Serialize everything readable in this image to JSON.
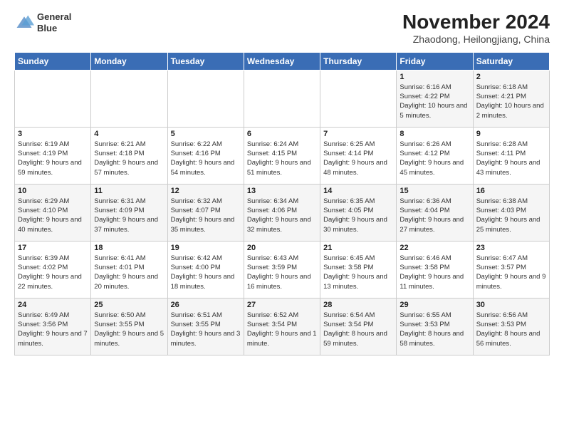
{
  "header": {
    "logo_line1": "General",
    "logo_line2": "Blue",
    "month_title": "November 2024",
    "location": "Zhaodong, Heilongjiang, China"
  },
  "weekdays": [
    "Sunday",
    "Monday",
    "Tuesday",
    "Wednesday",
    "Thursday",
    "Friday",
    "Saturday"
  ],
  "weeks": [
    [
      {
        "day": "",
        "info": ""
      },
      {
        "day": "",
        "info": ""
      },
      {
        "day": "",
        "info": ""
      },
      {
        "day": "",
        "info": ""
      },
      {
        "day": "",
        "info": ""
      },
      {
        "day": "1",
        "info": "Sunrise: 6:16 AM\nSunset: 4:22 PM\nDaylight: 10 hours and 5 minutes."
      },
      {
        "day": "2",
        "info": "Sunrise: 6:18 AM\nSunset: 4:21 PM\nDaylight: 10 hours and 2 minutes."
      }
    ],
    [
      {
        "day": "3",
        "info": "Sunrise: 6:19 AM\nSunset: 4:19 PM\nDaylight: 9 hours and 59 minutes."
      },
      {
        "day": "4",
        "info": "Sunrise: 6:21 AM\nSunset: 4:18 PM\nDaylight: 9 hours and 57 minutes."
      },
      {
        "day": "5",
        "info": "Sunrise: 6:22 AM\nSunset: 4:16 PM\nDaylight: 9 hours and 54 minutes."
      },
      {
        "day": "6",
        "info": "Sunrise: 6:24 AM\nSunset: 4:15 PM\nDaylight: 9 hours and 51 minutes."
      },
      {
        "day": "7",
        "info": "Sunrise: 6:25 AM\nSunset: 4:14 PM\nDaylight: 9 hours and 48 minutes."
      },
      {
        "day": "8",
        "info": "Sunrise: 6:26 AM\nSunset: 4:12 PM\nDaylight: 9 hours and 45 minutes."
      },
      {
        "day": "9",
        "info": "Sunrise: 6:28 AM\nSunset: 4:11 PM\nDaylight: 9 hours and 43 minutes."
      }
    ],
    [
      {
        "day": "10",
        "info": "Sunrise: 6:29 AM\nSunset: 4:10 PM\nDaylight: 9 hours and 40 minutes."
      },
      {
        "day": "11",
        "info": "Sunrise: 6:31 AM\nSunset: 4:09 PM\nDaylight: 9 hours and 37 minutes."
      },
      {
        "day": "12",
        "info": "Sunrise: 6:32 AM\nSunset: 4:07 PM\nDaylight: 9 hours and 35 minutes."
      },
      {
        "day": "13",
        "info": "Sunrise: 6:34 AM\nSunset: 4:06 PM\nDaylight: 9 hours and 32 minutes."
      },
      {
        "day": "14",
        "info": "Sunrise: 6:35 AM\nSunset: 4:05 PM\nDaylight: 9 hours and 30 minutes."
      },
      {
        "day": "15",
        "info": "Sunrise: 6:36 AM\nSunset: 4:04 PM\nDaylight: 9 hours and 27 minutes."
      },
      {
        "day": "16",
        "info": "Sunrise: 6:38 AM\nSunset: 4:03 PM\nDaylight: 9 hours and 25 minutes."
      }
    ],
    [
      {
        "day": "17",
        "info": "Sunrise: 6:39 AM\nSunset: 4:02 PM\nDaylight: 9 hours and 22 minutes."
      },
      {
        "day": "18",
        "info": "Sunrise: 6:41 AM\nSunset: 4:01 PM\nDaylight: 9 hours and 20 minutes."
      },
      {
        "day": "19",
        "info": "Sunrise: 6:42 AM\nSunset: 4:00 PM\nDaylight: 9 hours and 18 minutes."
      },
      {
        "day": "20",
        "info": "Sunrise: 6:43 AM\nSunset: 3:59 PM\nDaylight: 9 hours and 16 minutes."
      },
      {
        "day": "21",
        "info": "Sunrise: 6:45 AM\nSunset: 3:58 PM\nDaylight: 9 hours and 13 minutes."
      },
      {
        "day": "22",
        "info": "Sunrise: 6:46 AM\nSunset: 3:58 PM\nDaylight: 9 hours and 11 minutes."
      },
      {
        "day": "23",
        "info": "Sunrise: 6:47 AM\nSunset: 3:57 PM\nDaylight: 9 hours and 9 minutes."
      }
    ],
    [
      {
        "day": "24",
        "info": "Sunrise: 6:49 AM\nSunset: 3:56 PM\nDaylight: 9 hours and 7 minutes."
      },
      {
        "day": "25",
        "info": "Sunrise: 6:50 AM\nSunset: 3:55 PM\nDaylight: 9 hours and 5 minutes."
      },
      {
        "day": "26",
        "info": "Sunrise: 6:51 AM\nSunset: 3:55 PM\nDaylight: 9 hours and 3 minutes."
      },
      {
        "day": "27",
        "info": "Sunrise: 6:52 AM\nSunset: 3:54 PM\nDaylight: 9 hours and 1 minute."
      },
      {
        "day": "28",
        "info": "Sunrise: 6:54 AM\nSunset: 3:54 PM\nDaylight: 8 hours and 59 minutes."
      },
      {
        "day": "29",
        "info": "Sunrise: 6:55 AM\nSunset: 3:53 PM\nDaylight: 8 hours and 58 minutes."
      },
      {
        "day": "30",
        "info": "Sunrise: 6:56 AM\nSunset: 3:53 PM\nDaylight: 8 hours and 56 minutes."
      }
    ]
  ]
}
